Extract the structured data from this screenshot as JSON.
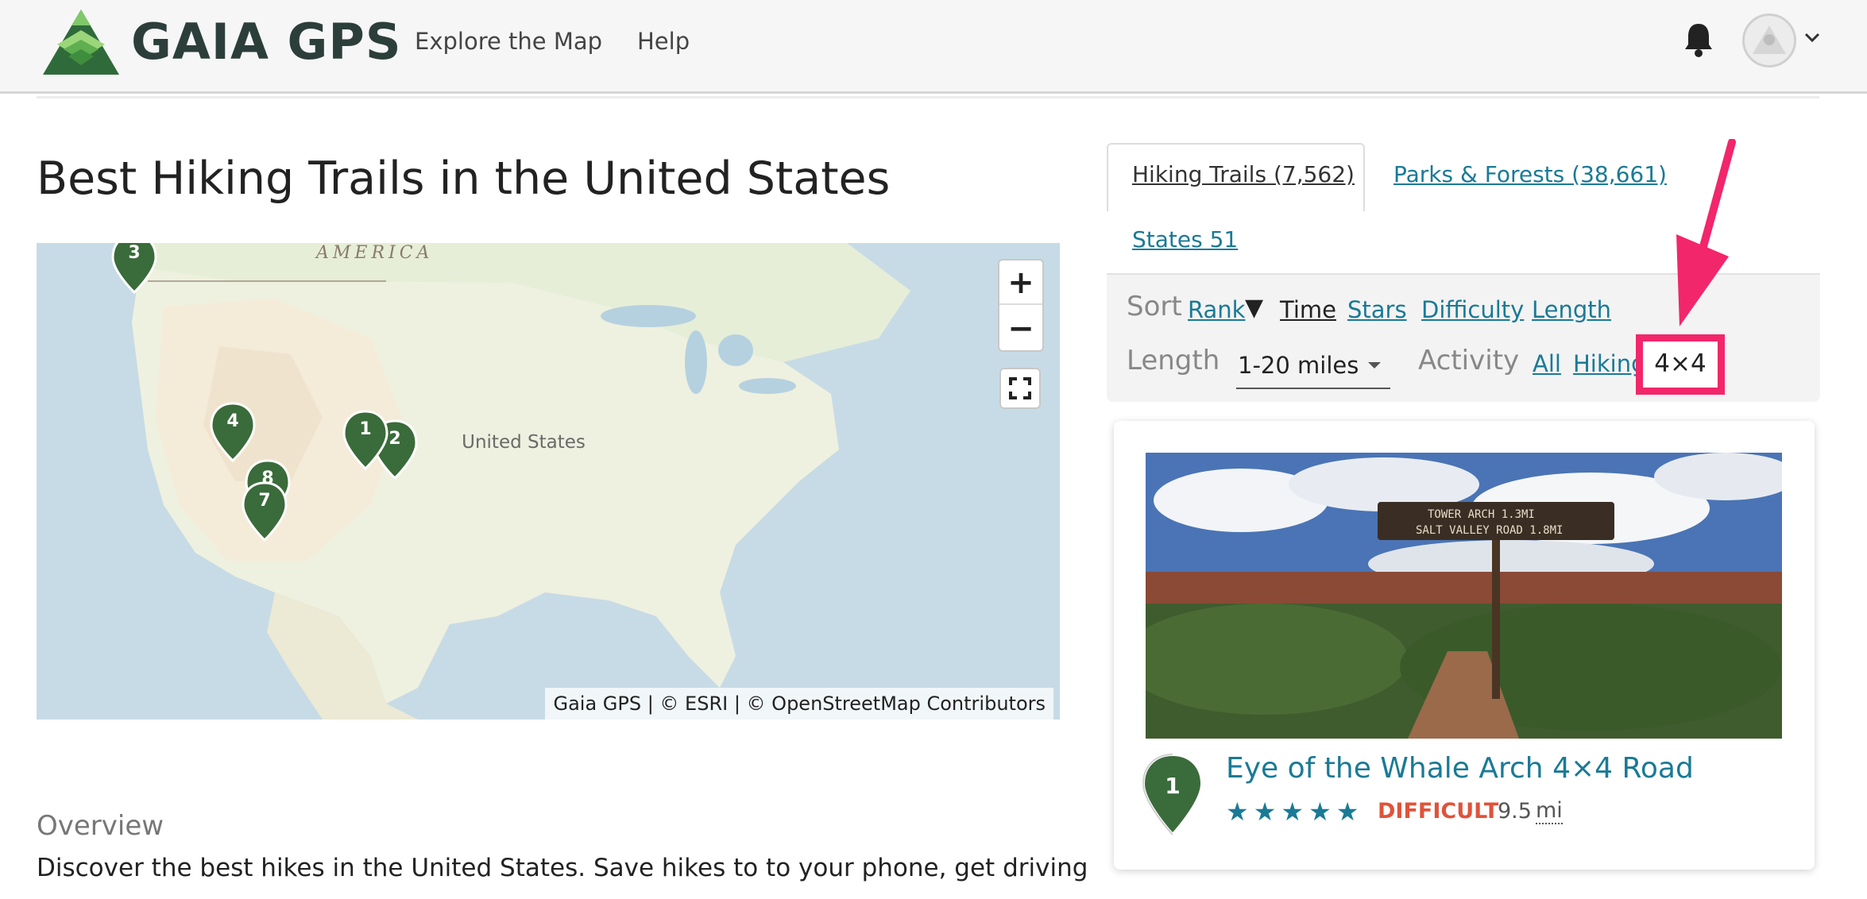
{
  "header": {
    "brand": "GAIA GPS",
    "nav": [
      {
        "label": "Explore the Map"
      },
      {
        "label": "Help"
      }
    ],
    "icons": [
      "gaia-logo-icon",
      "bell-icon",
      "avatar-icon",
      "chevron-down-icon"
    ]
  },
  "page": {
    "title": "Best Hiking Trails in the United States"
  },
  "map": {
    "label_region": "AMERICA",
    "label_country": "United States",
    "zoom_in": "+",
    "zoom_out": "−",
    "attribution": "Gaia GPS | © ESRI | © OpenStreetMap Contributors",
    "markers": [
      "3",
      "4",
      "1",
      "2",
      "8",
      "7"
    ]
  },
  "tabs": {
    "hiking": "Hiking Trails (7,562)",
    "parks": "Parks & Forests (38,661)",
    "states": "States 51"
  },
  "filters": {
    "sort_label": "Sort",
    "sort_options": {
      "rank": "Rank",
      "rank_arrow": "▼",
      "time": "Time",
      "stars": "Stars",
      "difficulty": "Difficulty",
      "length": "Length"
    },
    "length_label": "Length",
    "length_value": "1-20 miles",
    "activity_label": "Activity",
    "activity_options": {
      "all": "All",
      "hiking": "Hiking",
      "fourbyfour": "4×4"
    }
  },
  "card": {
    "rank": "1",
    "title": "Eye of the Whale Arch 4×4 Road",
    "stars": "★★★★★",
    "rating": 5,
    "difficulty": "DIFFICULT",
    "distance": "9.5",
    "distance_unit": "mi",
    "photo_sign_line1": "TOWER ARCH 1.3MI",
    "photo_sign_line2": "SALT VALLEY ROAD 1.8MI"
  },
  "overview": {
    "heading": "Overview",
    "text": "Discover the best hikes in the United States. Save hikes to to your phone, get driving"
  },
  "colors": {
    "brand_green": "#3a6b3a",
    "link_teal": "#1a7a96",
    "difficult_red": "#e0533a",
    "highlight_pink": "#f2266a"
  }
}
